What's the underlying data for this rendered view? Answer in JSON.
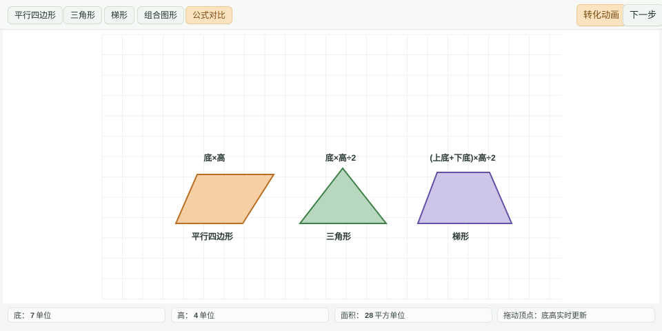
{
  "toolbar": {
    "tabs": [
      {
        "label": "平行四边形"
      },
      {
        "label": "三角形"
      },
      {
        "label": "梯形"
      },
      {
        "label": "组合图形"
      },
      {
        "label": "公式对比",
        "active": true
      }
    ],
    "animate_label": "转化动画",
    "next_label": "下一步"
  },
  "canvas": {
    "shapes": [
      {
        "name": "平行四边形",
        "formula": "底×高",
        "fill": "#f7cfa4",
        "stroke": "#b86e23"
      },
      {
        "name": "三角形",
        "formula": "底×高÷2",
        "fill": "#b7d7be",
        "stroke": "#3f8048"
      },
      {
        "name": "梯形",
        "formula": "(上底+下底)×高÷2",
        "fill": "#cdc6e8",
        "stroke": "#6450a6"
      }
    ]
  },
  "status": {
    "base_label": "底：",
    "base_value": "7",
    "base_unit": "单位",
    "height_label": "高：",
    "height_value": "4",
    "height_unit": "单位",
    "area_label": "面积：",
    "area_value": "28",
    "area_unit": "平方单位",
    "hint": "拖动顶点：底高实时更新"
  },
  "colors": {
    "accent_active": "#fbe3bf",
    "grid": "#eef1ee"
  }
}
